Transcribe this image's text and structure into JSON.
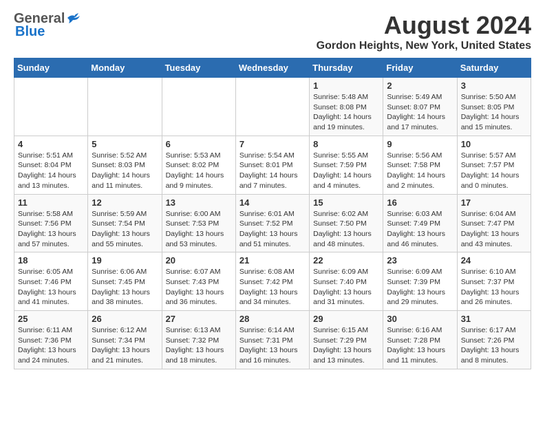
{
  "header": {
    "logo_general": "General",
    "logo_blue": "Blue",
    "month_title": "August 2024",
    "location": "Gordon Heights, New York, United States"
  },
  "days_of_week": [
    "Sunday",
    "Monday",
    "Tuesday",
    "Wednesday",
    "Thursday",
    "Friday",
    "Saturday"
  ],
  "weeks": [
    [
      {
        "day": "",
        "info": ""
      },
      {
        "day": "",
        "info": ""
      },
      {
        "day": "",
        "info": ""
      },
      {
        "day": "",
        "info": ""
      },
      {
        "day": "1",
        "info": "Sunrise: 5:48 AM\nSunset: 8:08 PM\nDaylight: 14 hours\nand 19 minutes."
      },
      {
        "day": "2",
        "info": "Sunrise: 5:49 AM\nSunset: 8:07 PM\nDaylight: 14 hours\nand 17 minutes."
      },
      {
        "day": "3",
        "info": "Sunrise: 5:50 AM\nSunset: 8:05 PM\nDaylight: 14 hours\nand 15 minutes."
      }
    ],
    [
      {
        "day": "4",
        "info": "Sunrise: 5:51 AM\nSunset: 8:04 PM\nDaylight: 14 hours\nand 13 minutes."
      },
      {
        "day": "5",
        "info": "Sunrise: 5:52 AM\nSunset: 8:03 PM\nDaylight: 14 hours\nand 11 minutes."
      },
      {
        "day": "6",
        "info": "Sunrise: 5:53 AM\nSunset: 8:02 PM\nDaylight: 14 hours\nand 9 minutes."
      },
      {
        "day": "7",
        "info": "Sunrise: 5:54 AM\nSunset: 8:01 PM\nDaylight: 14 hours\nand 7 minutes."
      },
      {
        "day": "8",
        "info": "Sunrise: 5:55 AM\nSunset: 7:59 PM\nDaylight: 14 hours\nand 4 minutes."
      },
      {
        "day": "9",
        "info": "Sunrise: 5:56 AM\nSunset: 7:58 PM\nDaylight: 14 hours\nand 2 minutes."
      },
      {
        "day": "10",
        "info": "Sunrise: 5:57 AM\nSunset: 7:57 PM\nDaylight: 14 hours\nand 0 minutes."
      }
    ],
    [
      {
        "day": "11",
        "info": "Sunrise: 5:58 AM\nSunset: 7:56 PM\nDaylight: 13 hours\nand 57 minutes."
      },
      {
        "day": "12",
        "info": "Sunrise: 5:59 AM\nSunset: 7:54 PM\nDaylight: 13 hours\nand 55 minutes."
      },
      {
        "day": "13",
        "info": "Sunrise: 6:00 AM\nSunset: 7:53 PM\nDaylight: 13 hours\nand 53 minutes."
      },
      {
        "day": "14",
        "info": "Sunrise: 6:01 AM\nSunset: 7:52 PM\nDaylight: 13 hours\nand 51 minutes."
      },
      {
        "day": "15",
        "info": "Sunrise: 6:02 AM\nSunset: 7:50 PM\nDaylight: 13 hours\nand 48 minutes."
      },
      {
        "day": "16",
        "info": "Sunrise: 6:03 AM\nSunset: 7:49 PM\nDaylight: 13 hours\nand 46 minutes."
      },
      {
        "day": "17",
        "info": "Sunrise: 6:04 AM\nSunset: 7:47 PM\nDaylight: 13 hours\nand 43 minutes."
      }
    ],
    [
      {
        "day": "18",
        "info": "Sunrise: 6:05 AM\nSunset: 7:46 PM\nDaylight: 13 hours\nand 41 minutes."
      },
      {
        "day": "19",
        "info": "Sunrise: 6:06 AM\nSunset: 7:45 PM\nDaylight: 13 hours\nand 38 minutes."
      },
      {
        "day": "20",
        "info": "Sunrise: 6:07 AM\nSunset: 7:43 PM\nDaylight: 13 hours\nand 36 minutes."
      },
      {
        "day": "21",
        "info": "Sunrise: 6:08 AM\nSunset: 7:42 PM\nDaylight: 13 hours\nand 34 minutes."
      },
      {
        "day": "22",
        "info": "Sunrise: 6:09 AM\nSunset: 7:40 PM\nDaylight: 13 hours\nand 31 minutes."
      },
      {
        "day": "23",
        "info": "Sunrise: 6:09 AM\nSunset: 7:39 PM\nDaylight: 13 hours\nand 29 minutes."
      },
      {
        "day": "24",
        "info": "Sunrise: 6:10 AM\nSunset: 7:37 PM\nDaylight: 13 hours\nand 26 minutes."
      }
    ],
    [
      {
        "day": "25",
        "info": "Sunrise: 6:11 AM\nSunset: 7:36 PM\nDaylight: 13 hours\nand 24 minutes."
      },
      {
        "day": "26",
        "info": "Sunrise: 6:12 AM\nSunset: 7:34 PM\nDaylight: 13 hours\nand 21 minutes."
      },
      {
        "day": "27",
        "info": "Sunrise: 6:13 AM\nSunset: 7:32 PM\nDaylight: 13 hours\nand 18 minutes."
      },
      {
        "day": "28",
        "info": "Sunrise: 6:14 AM\nSunset: 7:31 PM\nDaylight: 13 hours\nand 16 minutes."
      },
      {
        "day": "29",
        "info": "Sunrise: 6:15 AM\nSunset: 7:29 PM\nDaylight: 13 hours\nand 13 minutes."
      },
      {
        "day": "30",
        "info": "Sunrise: 6:16 AM\nSunset: 7:28 PM\nDaylight: 13 hours\nand 11 minutes."
      },
      {
        "day": "31",
        "info": "Sunrise: 6:17 AM\nSunset: 7:26 PM\nDaylight: 13 hours\nand 8 minutes."
      }
    ]
  ]
}
